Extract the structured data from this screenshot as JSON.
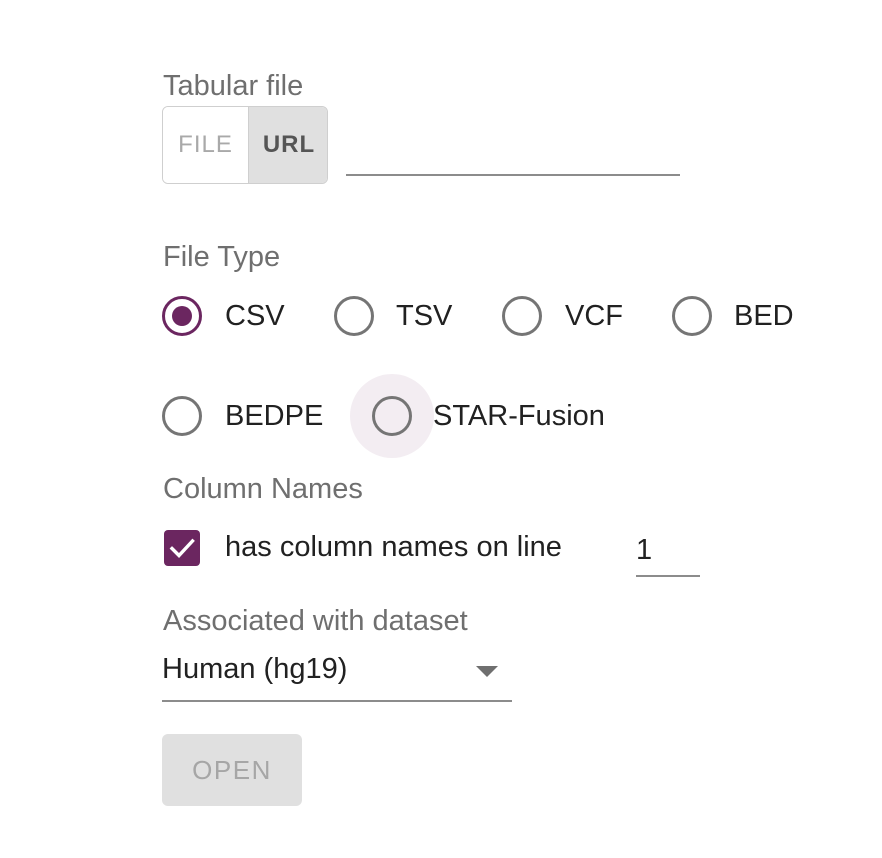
{
  "tabular_file": {
    "label": "Tabular file",
    "file_button": "FILE",
    "url_button": "URL",
    "url_value": ""
  },
  "file_type": {
    "label": "File Type",
    "selected": "CSV",
    "options": [
      "CSV",
      "TSV",
      "VCF",
      "BED",
      "BEDPE",
      "STAR-Fusion"
    ]
  },
  "column_names": {
    "label": "Column Names",
    "checkbox_label": "has column names on line",
    "checked": true,
    "line_number": "1"
  },
  "dataset": {
    "label": "Associated with dataset",
    "selected": "Human (hg19)"
  },
  "open_button": "OPEN",
  "colors": {
    "accent": "#6b2660",
    "disabled_bg": "#e0e0e0",
    "label_gray": "#6f6f6f"
  }
}
